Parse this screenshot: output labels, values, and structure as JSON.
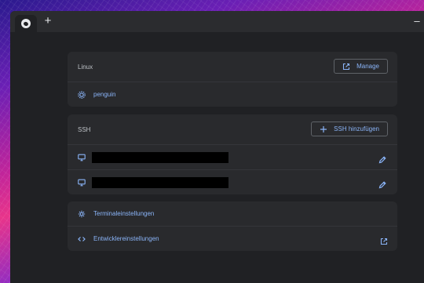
{
  "titlebar": {
    "newtab_label": "+",
    "minimize_label": "–"
  },
  "linux": {
    "header": "Linux",
    "manage_label": "Manage",
    "container": "penguin"
  },
  "ssh": {
    "header": "SSH",
    "add_label": "SSH hinzufügen",
    "connections": [
      "",
      ""
    ]
  },
  "settings": {
    "terminal_label": "Terminaleinstellungen",
    "developer_label": "Entwicklereinstellungen"
  },
  "colors": {
    "accent": "#8ab4f8",
    "background": "#202124",
    "card": "#292a2d"
  }
}
